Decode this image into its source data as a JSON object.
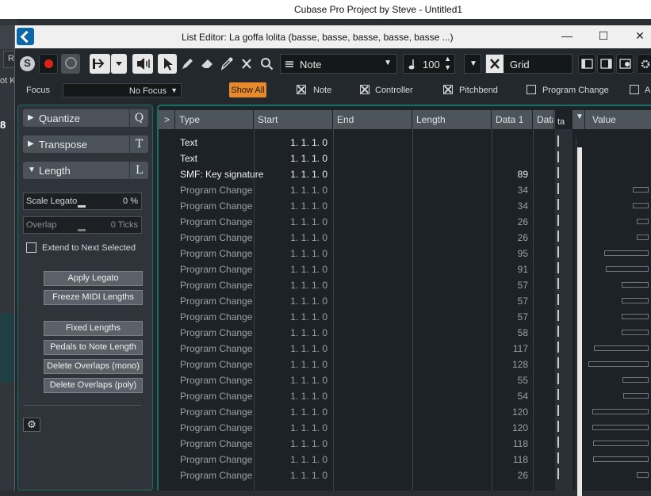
{
  "main_window": {
    "title": "Cubase Pro Project by Steve - Untitled1"
  },
  "host_fragments": {
    "r_label": "R",
    "otk_label": "ot K",
    "bar_number": "8"
  },
  "list_editor": {
    "title": "List Editor: La goffa lolita (basse, basse, basse, basse, basse ...)",
    "window_controls": {
      "minimize": "—",
      "maximize": "☐",
      "close": "✕"
    }
  },
  "toolbar": {
    "solo_label": "S",
    "event_type": "Note",
    "velocity": "100",
    "grid_label": "Grid"
  },
  "focus_bar": {
    "focus_label": "Focus",
    "focus_value": "No Focus",
    "show_all": "Show All",
    "filters": [
      {
        "label": "Note",
        "checked": true
      },
      {
        "label": "Controller",
        "checked": true
      },
      {
        "label": "Pitchbend",
        "checked": true
      },
      {
        "label": "Program Change",
        "checked": false
      },
      {
        "label": "A",
        "checked": false
      }
    ]
  },
  "left_panel": {
    "sections": [
      {
        "label": "Quantize",
        "key": "Q",
        "expanded": false
      },
      {
        "label": "Transpose",
        "key": "T",
        "expanded": false
      },
      {
        "label": "Length",
        "key": "L",
        "expanded": true
      }
    ],
    "scale_legato": {
      "label": "Scale Legato",
      "value": "0 %"
    },
    "overlap": {
      "label": "Overlap",
      "value": "0 Ticks"
    },
    "extend_label": "Extend to Next Selected",
    "buttons": [
      "Apply Legato",
      "Freeze MIDI Lengths",
      "Fixed Lengths",
      "Pedals to Note Length",
      "Delete Overlaps (mono)",
      "Delete Overlaps (poly)"
    ]
  },
  "table": {
    "columns": [
      ">",
      "Type",
      "Start",
      "End",
      "Length",
      "Data 1",
      "Data",
      "ta",
      "Value"
    ],
    "rows": [
      {
        "type": "Text",
        "start": "1.  1.  1.    0",
        "data1": "",
        "value": 0,
        "bright": true
      },
      {
        "type": "Text",
        "start": "1.  1.  1.    0",
        "data1": "",
        "value": 0,
        "bright": true
      },
      {
        "type": "SMF: Key signature",
        "start": "1.  1.  1.    0",
        "data1": "89",
        "value": 0,
        "bright": true
      },
      {
        "type": "Program Change",
        "start": "1.  1.  1.    0",
        "data1": "34",
        "value": 34,
        "bright": false
      },
      {
        "type": "Program Change",
        "start": "1.  1.  1.    0",
        "data1": "34",
        "value": 34,
        "bright": false
      },
      {
        "type": "Program Change",
        "start": "1.  1.  1.    0",
        "data1": "26",
        "value": 26,
        "bright": false
      },
      {
        "type": "Program Change",
        "start": "1.  1.  1.    0",
        "data1": "26",
        "value": 26,
        "bright": false
      },
      {
        "type": "Program Change",
        "start": "1.  1.  1.    0",
        "data1": "95",
        "value": 95,
        "bright": false
      },
      {
        "type": "Program Change",
        "start": "1.  1.  1.    0",
        "data1": "91",
        "value": 91,
        "bright": false
      },
      {
        "type": "Program Change",
        "start": "1.  1.  1.    0",
        "data1": "57",
        "value": 57,
        "bright": false
      },
      {
        "type": "Program Change",
        "start": "1.  1.  1.    0",
        "data1": "57",
        "value": 57,
        "bright": false
      },
      {
        "type": "Program Change",
        "start": "1.  1.  1.    0",
        "data1": "57",
        "value": 57,
        "bright": false
      },
      {
        "type": "Program Change",
        "start": "1.  1.  1.    0",
        "data1": "58",
        "value": 58,
        "bright": false
      },
      {
        "type": "Program Change",
        "start": "1.  1.  1.    0",
        "data1": "117",
        "value": 117,
        "bright": false
      },
      {
        "type": "Program Change",
        "start": "1.  1.  1.    0",
        "data1": "128",
        "value": 128,
        "bright": false
      },
      {
        "type": "Program Change",
        "start": "1.  1.  1.    0",
        "data1": "55",
        "value": 55,
        "bright": false
      },
      {
        "type": "Program Change",
        "start": "1.  1.  1.    0",
        "data1": "54",
        "value": 54,
        "bright": false
      },
      {
        "type": "Program Change",
        "start": "1.  1.  1.    0",
        "data1": "120",
        "value": 120,
        "bright": false
      },
      {
        "type": "Program Change",
        "start": "1.  1.  1.    0",
        "data1": "120",
        "value": 120,
        "bright": false
      },
      {
        "type": "Program Change",
        "start": "1.  1.  1.    0",
        "data1": "118",
        "value": 118,
        "bright": false
      },
      {
        "type": "Program Change",
        "start": "1.  1.  1.    0",
        "data1": "118",
        "value": 118,
        "bright": false
      },
      {
        "type": "Program Change",
        "start": "1.  1.  1.    0",
        "data1": "26",
        "value": 26,
        "bright": false
      }
    ]
  },
  "colors": {
    "accent_teal": "#1a6e66",
    "show_all_orange": "#e98a2a",
    "record_red": "#e0201a"
  }
}
